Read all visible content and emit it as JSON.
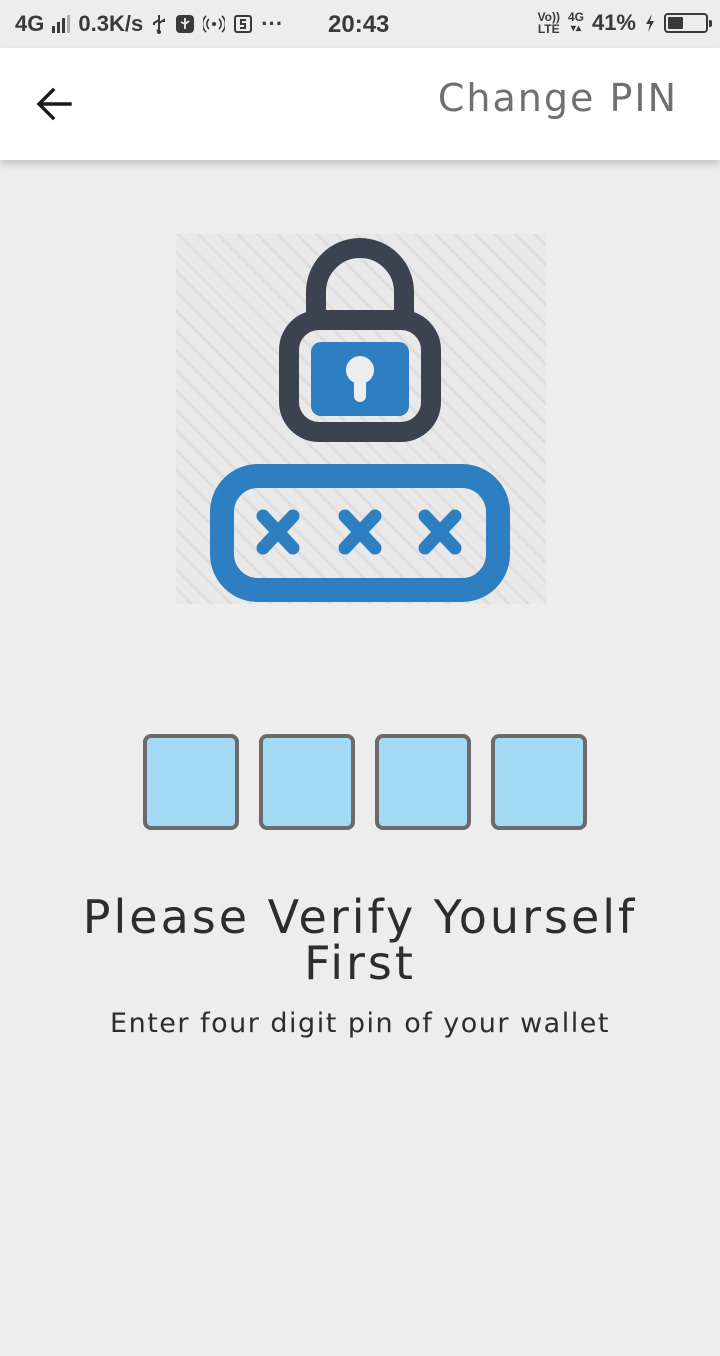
{
  "status_bar": {
    "network": "4G",
    "speed": "0.3K/s",
    "more": "···",
    "time": "20:43",
    "volte_top": "Vo))",
    "volte_bottom": "LTE",
    "network_right": "4G",
    "battery_percent": "41%",
    "battery_level": 0.41,
    "icons": [
      "signal-icon",
      "usb-icon",
      "usb-debug-icon",
      "hotspot-icon",
      "screenshot-icon",
      "volte-icon",
      "data-arrows-icon",
      "charging-icon",
      "battery-icon"
    ]
  },
  "app_bar": {
    "back_icon": "arrow-left-icon",
    "title": "Change PIN"
  },
  "illustration": {
    "icon": "lock-pin-icon",
    "colors": {
      "lock_body": "#3c4350",
      "accent_blue": "#2d7fc1",
      "hatch_bg": "#e2e2e2"
    },
    "masked_chars": 3
  },
  "pin_input": {
    "digits": [
      "",
      "",
      "",
      ""
    ],
    "box_fill": "#a4daf4",
    "box_border": "#6b6b6b"
  },
  "verify": {
    "title": "Please Verify Yourself First",
    "subtitle": "Enter four digit pin of your wallet"
  },
  "colors": {
    "background": "#ededed",
    "app_bar": "#ffffff",
    "title_text": "#707070",
    "body_text": "#2d2d2d"
  }
}
